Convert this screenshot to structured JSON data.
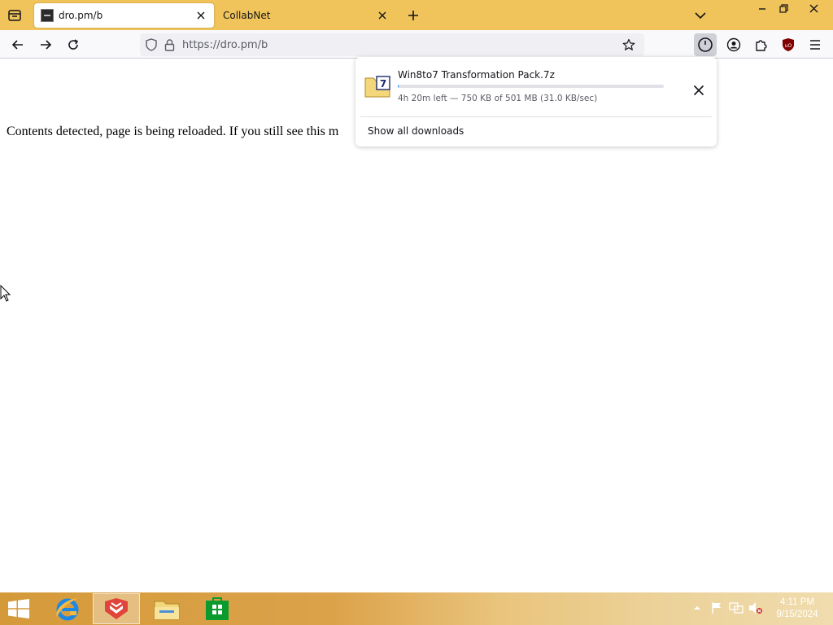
{
  "tabs": [
    {
      "title": "dro.pm/b",
      "active": true
    },
    {
      "title": "CollabNet",
      "active": false
    }
  ],
  "navbar": {
    "url": "https://dro.pm/b"
  },
  "page": {
    "message": "Contents detected, page is being reloaded. If you still see this m"
  },
  "downloads_panel": {
    "item": {
      "filename": "Win8to7 Transformation Pack.7z",
      "status": "4h 20m left — 750 KB of 501 MB (31.0 KB/sec)",
      "progress_fraction": 0.0015
    },
    "show_all_label": "Show all downloads"
  },
  "taskbar": {
    "apps": [
      "internet-explorer",
      "firefox-developer",
      "file-explorer",
      "windows-store"
    ],
    "clock": {
      "time": "4:11 PM",
      "date": "9/15/2024"
    }
  },
  "colors": {
    "titlebar": "#f0c45a",
    "navbar": "#f9f9fb",
    "progress_fill": "#0a84ff",
    "taskbar": "#d49a3a"
  }
}
